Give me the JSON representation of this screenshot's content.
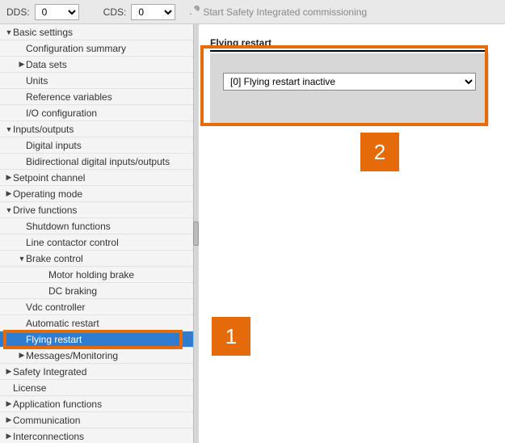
{
  "toolbar": {
    "dds_label": "DDS:",
    "dds_value": "0",
    "cds_label": "CDS:",
    "cds_value": "0",
    "safety_label": "Start Safety Integrated commissioning"
  },
  "sidebar": {
    "items": [
      {
        "label": "Basic settings",
        "indent": 0,
        "caret": "down"
      },
      {
        "label": "Configuration summary",
        "indent": 1,
        "caret": ""
      },
      {
        "label": "Data sets",
        "indent": 1,
        "caret": "right"
      },
      {
        "label": "Units",
        "indent": 1,
        "caret": ""
      },
      {
        "label": "Reference variables",
        "indent": 1,
        "caret": ""
      },
      {
        "label": "I/O configuration",
        "indent": 1,
        "caret": ""
      },
      {
        "label": "Inputs/outputs",
        "indent": 0,
        "caret": "down"
      },
      {
        "label": "Digital inputs",
        "indent": 1,
        "caret": ""
      },
      {
        "label": "Bidirectional digital inputs/outputs",
        "indent": 1,
        "caret": ""
      },
      {
        "label": "Setpoint channel",
        "indent": 0,
        "caret": "right"
      },
      {
        "label": "Operating mode",
        "indent": 0,
        "caret": "right"
      },
      {
        "label": "Drive functions",
        "indent": 0,
        "caret": "down"
      },
      {
        "label": "Shutdown functions",
        "indent": 1,
        "caret": ""
      },
      {
        "label": "Line contactor control",
        "indent": 1,
        "caret": ""
      },
      {
        "label": "Brake control",
        "indent": 1,
        "caret": "down"
      },
      {
        "label": "Motor holding brake",
        "indent": 3,
        "caret": ""
      },
      {
        "label": "DC braking",
        "indent": 3,
        "caret": ""
      },
      {
        "label": "Vdc controller",
        "indent": 1,
        "caret": ""
      },
      {
        "label": "Automatic restart",
        "indent": 1,
        "caret": ""
      },
      {
        "label": "Flying restart",
        "indent": 1,
        "caret": "",
        "selected": true
      },
      {
        "label": "Messages/Monitoring",
        "indent": 1,
        "caret": "right"
      },
      {
        "label": "Safety Integrated",
        "indent": 0,
        "caret": "right"
      },
      {
        "label": "License",
        "indent": 0,
        "caret": ""
      },
      {
        "label": "Application functions",
        "indent": 0,
        "caret": "right"
      },
      {
        "label": "Communication",
        "indent": 0,
        "caret": "right"
      },
      {
        "label": "Interconnections",
        "indent": 0,
        "caret": "right"
      }
    ]
  },
  "content": {
    "title": "Flying restart",
    "option_selected": "[0] Flying restart inactive"
  },
  "callouts": {
    "b1": "1",
    "b2": "2"
  }
}
